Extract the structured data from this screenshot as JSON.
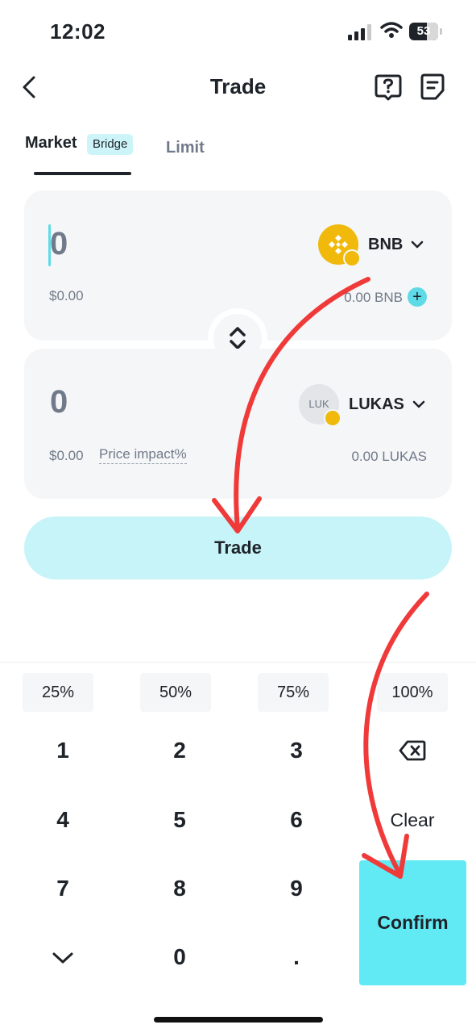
{
  "status_bar": {
    "time": "12:02",
    "battery": "53"
  },
  "header": {
    "title": "Trade",
    "back_icon": "chevron-left-icon",
    "help_icon": "question-icon",
    "orders_icon": "document-icon"
  },
  "tabs": {
    "market": "Market",
    "bridge_badge": "Bridge",
    "limit": "Limit"
  },
  "from": {
    "amount": "0",
    "fiat": "$0.00",
    "token": "BNB",
    "balance": "0.00 BNB",
    "plus": "+"
  },
  "to": {
    "amount": "0",
    "fiat": "$0.00",
    "price_impact": "Price impact%",
    "token": "LUKAS",
    "logo_text": "LUK",
    "balance": "0.00 LUKAS"
  },
  "trade_button": "Trade",
  "keypad": {
    "percents": [
      "25%",
      "50%",
      "75%",
      "100%"
    ],
    "keys": [
      "1",
      "2",
      "3",
      "4",
      "5",
      "6",
      "7",
      "8",
      "9",
      "0",
      "."
    ],
    "clear": "Clear",
    "confirm": "Confirm"
  },
  "colors": {
    "accent": "#62eaf4",
    "trade_button": "#c6f4f8",
    "bnb": "#f0b90b",
    "annotation_arrow": "#f03a3a"
  }
}
